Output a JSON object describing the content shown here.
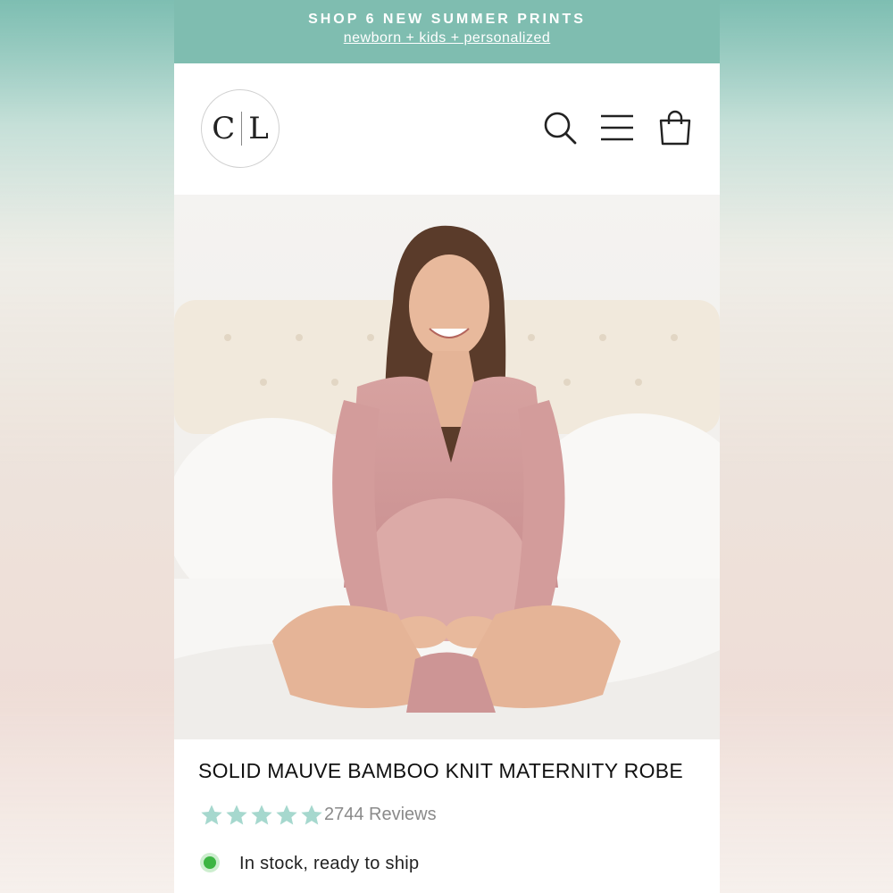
{
  "promo": {
    "title": "SHOP 6 NEW SUMMER PRINTS",
    "link": "newborn + kids + personalized"
  },
  "header": {
    "logo_left": "C",
    "logo_right": "L",
    "icons": [
      "search-icon",
      "menu-icon",
      "cart-icon"
    ]
  },
  "hero": {
    "image": "woman-in-mauve-robe-on-bed"
  },
  "product": {
    "title": "SOLID MAUVE BAMBOO KNIT MATERNITY ROBE",
    "rating": 5,
    "reviews": "2744 Reviews",
    "stock": "In stock, ready to ship"
  },
  "colors": {
    "accent": "#7fbdb0",
    "star": "#a6d8ce",
    "stock": "#3db543"
  }
}
